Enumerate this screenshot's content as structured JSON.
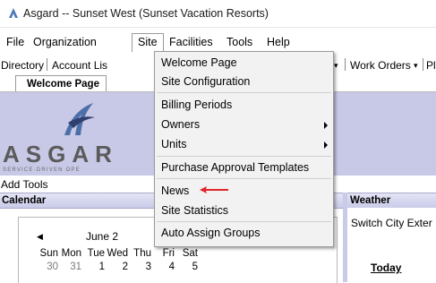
{
  "window": {
    "title": "Asgard -- Sunset West (Sunset Vacation Resorts)",
    "icon": "asgard-app-icon"
  },
  "menubar": {
    "items": [
      {
        "label": "File"
      },
      {
        "label": "Organization"
      },
      {
        "label": "Site",
        "active": true
      },
      {
        "label": "Facilities"
      },
      {
        "label": "Tools"
      },
      {
        "label": "Help"
      }
    ]
  },
  "toolbar": {
    "items": [
      {
        "label": "Directory"
      },
      {
        "label": "Account Lis"
      },
      {
        "label": "Work Orders"
      },
      {
        "label": "Pl"
      }
    ]
  },
  "tabs": [
    {
      "label": "Welcome Page"
    }
  ],
  "logo": {
    "word": "ASGAR",
    "tagline": "SERVICE-DRIVEN OPE"
  },
  "add_tools": "Add Tools",
  "calendar": {
    "header": "Calendar",
    "prev_icon": "triangle-left-icon",
    "month": "June 2",
    "days": [
      "Sun",
      "Mon",
      "Tue",
      "Wed",
      "Thu",
      "Fri",
      "Sat"
    ],
    "dates": [
      "30",
      "31",
      "1",
      "2",
      "3",
      "4",
      "5"
    ]
  },
  "weather": {
    "header": "Weather",
    "switch_label": "Switch City  Exter",
    "today_label": "Today"
  },
  "site_menu": {
    "items": [
      {
        "label": "Welcome Page"
      },
      {
        "label": "Site Configuration"
      },
      {
        "label": "Billing Periods"
      },
      {
        "label": "Owners",
        "submenu": true
      },
      {
        "label": "Units",
        "submenu": true
      },
      {
        "label": "Purchase Approval Templates"
      },
      {
        "label": "News",
        "highlighted_by_arrow": true
      },
      {
        "label": "Site Statistics"
      },
      {
        "label": "Auto Assign Groups"
      }
    ]
  },
  "colors": {
    "banner": "#c8c9e6",
    "arrow": "#e0262a",
    "panel_header": "#c9cbe8"
  }
}
